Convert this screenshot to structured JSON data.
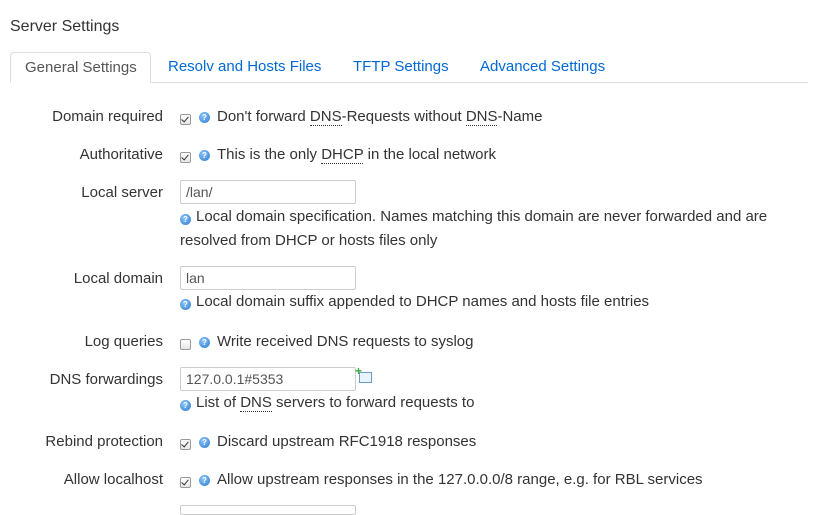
{
  "section_title": "Server Settings",
  "tabs": [
    {
      "label": "General Settings",
      "active": true
    },
    {
      "label": "Resolv and Hosts Files",
      "active": false
    },
    {
      "label": "TFTP Settings",
      "active": false
    },
    {
      "label": "Advanced Settings",
      "active": false
    }
  ],
  "fields": {
    "domain_required": {
      "label": "Domain required",
      "checked": true,
      "desc_pre": "Don't forward ",
      "abbr1": "DNS",
      "desc_mid": "-Requests without ",
      "abbr2": "DNS",
      "desc_post": "-Name"
    },
    "authoritative": {
      "label": "Authoritative",
      "checked": true,
      "desc_pre": "This is the only ",
      "abbr1": "DHCP",
      "desc_post": " in the local network"
    },
    "local_server": {
      "label": "Local server",
      "value": "/lan/",
      "desc": "Local domain specification. Names matching this domain are never forwarded and are resolved from DHCP or hosts files only"
    },
    "local_domain": {
      "label": "Local domain",
      "value": "lan",
      "desc": "Local domain suffix appended to DHCP names and hosts file entries"
    },
    "log_queries": {
      "label": "Log queries",
      "checked": false,
      "desc": "Write received DNS requests to syslog"
    },
    "dns_forwardings": {
      "label": "DNS forwardings",
      "value": "127.0.0.1#5353",
      "desc_pre": "List of ",
      "abbr1": "DNS",
      "desc_post": " servers to forward requests to"
    },
    "rebind_protection": {
      "label": "Rebind protection",
      "checked": true,
      "desc": "Discard upstream RFC1918 responses"
    },
    "allow_localhost": {
      "label": "Allow localhost",
      "checked": true,
      "desc": "Allow upstream responses in the 127.0.0.0/8 range, e.g. for RBL services"
    }
  },
  "icons": {
    "help": "help-icon",
    "add": "add-entry-icon"
  },
  "colors": {
    "link": "#0069d6",
    "help": "#2a79c9",
    "text": "#333333"
  }
}
